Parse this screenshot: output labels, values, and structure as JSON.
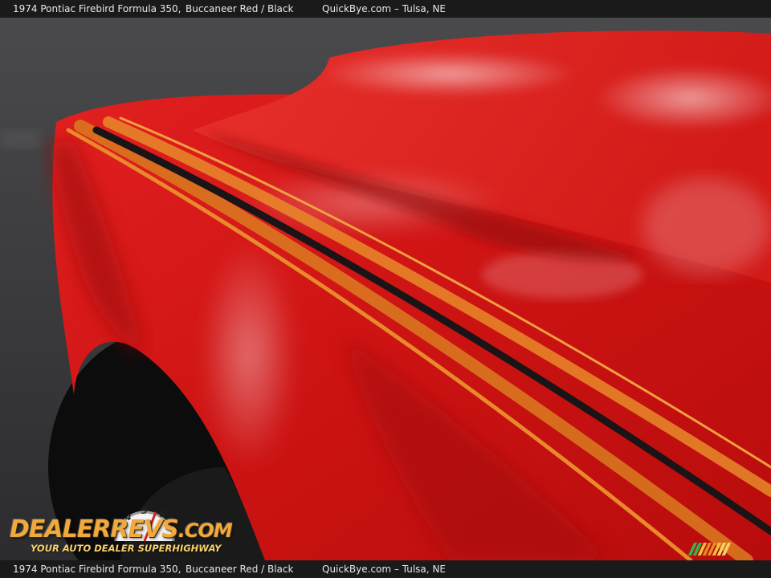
{
  "caption": {
    "title": "1974 Pontiac Firebird Formula 350,",
    "color": "Buccaneer Red / Black",
    "site": "QuickBye.com – Tulsa, NE"
  },
  "watermark": {
    "brand_main": "DEALERREVS",
    "brand_suffix": ".COM",
    "tagline": "YOUR AUTO DEALER SUPERHIGHWAY",
    "gauge_icon": "speedometer-icon",
    "corner_icon": "color-stripes-icon"
  },
  "colors": {
    "paint": "#d81a1a",
    "stripe_orange": "#e8892a",
    "stripe_black": "#1b1416",
    "asphalt": "#3a3a3c"
  }
}
